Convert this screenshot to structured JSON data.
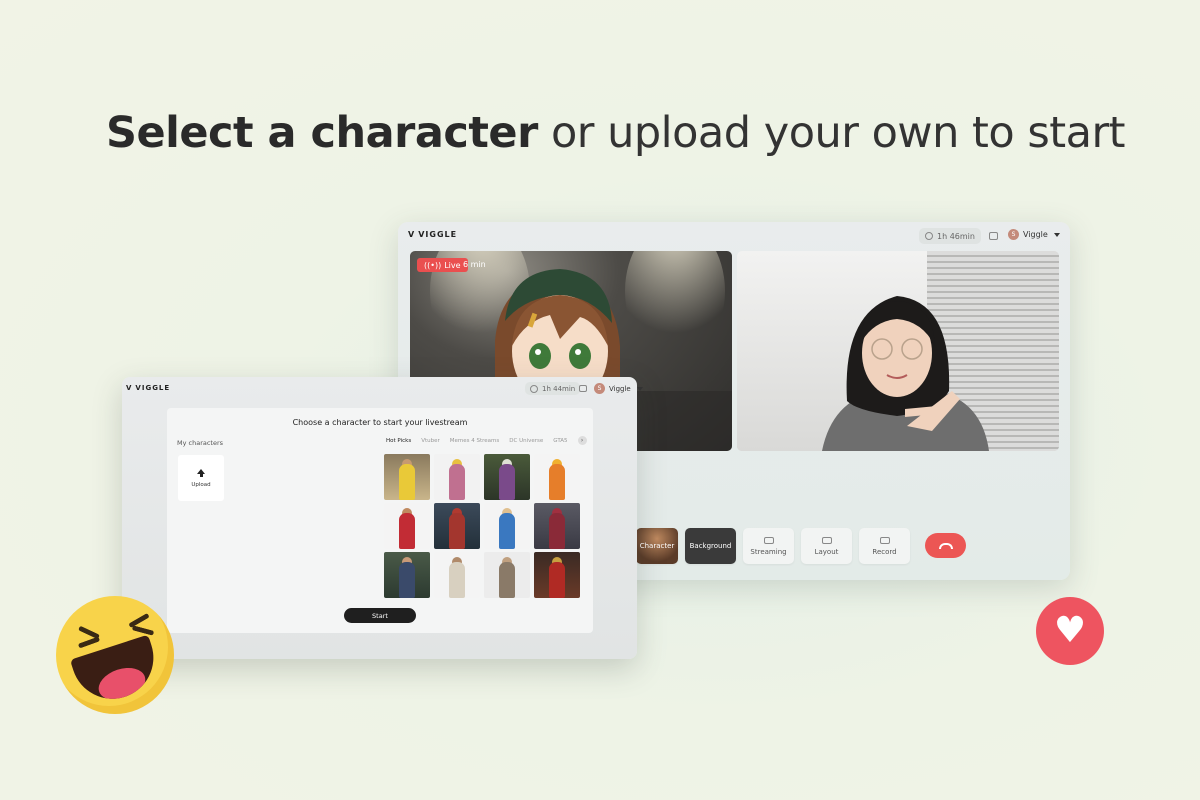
{
  "headline": {
    "bold": "Select a character",
    "rest": "or upload your own to start"
  },
  "back_window": {
    "logo": "VIGGLE",
    "timer": "1h 46min",
    "user_initial": "S",
    "user_name": "Viggle",
    "live_label": "Live",
    "live_minutes": "6 min",
    "toolbar": [
      "Character",
      "Background",
      "Streaming",
      "Layout",
      "Record"
    ]
  },
  "front_window": {
    "logo": "VIGGLE",
    "timer": "1h 44min",
    "user_initial": "S",
    "user_name": "Viggle",
    "title": "Choose a character to start your livestream",
    "my_characters": "My characters",
    "upload": "Upload",
    "tabs": [
      "Hot Picks",
      "Vtuber",
      "Memes 4 Streams",
      "DC Universe",
      "GTA5"
    ],
    "start": "Start"
  },
  "colors": {
    "accent_red": "#ea4f4f",
    "dark": "#1f1f1f"
  }
}
